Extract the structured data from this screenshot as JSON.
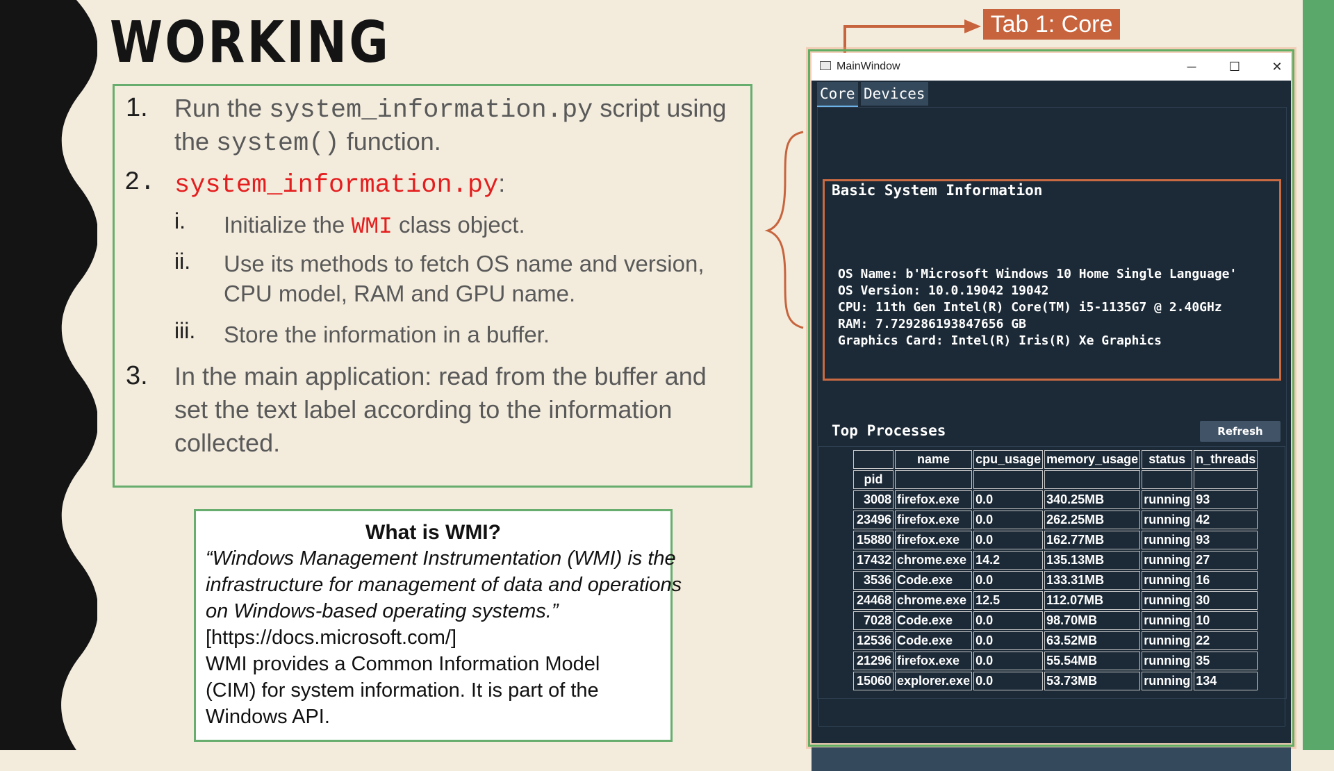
{
  "slide": {
    "title": "WORKING",
    "steps": [
      {
        "num": "1.",
        "line1_a": "Run the ",
        "line1_code": "system_information.py",
        "line1_b": " script using",
        "line2_a": "the ",
        "line2_code": "system()",
        "line2_b": " function."
      },
      {
        "num": "2.",
        "code": "system_information.py",
        "colon": ":"
      },
      {
        "num": "3.",
        "lines": [
          "In the main application: read from the buffer and",
          "set the text label according to the information",
          "collected."
        ]
      }
    ],
    "substeps": [
      {
        "num": "i.",
        "a": "Initialize the ",
        "code": "WMI",
        "b": " class object."
      },
      {
        "num": "ii.",
        "lines": [
          "Use its methods to fetch OS name and version,",
          "CPU model, RAM and GPU name."
        ]
      },
      {
        "num": "iii.",
        "text": "Store the information in a buffer."
      }
    ],
    "wmi": {
      "title": "What is WMI?",
      "quote": [
        "“Windows Management Instrumentation (WMI) is the",
        "infrastructure for management of data and operations",
        "on Windows-based operating systems.”"
      ],
      "source": "[https://docs.microsoft.com/]",
      "body": [
        "WMI provides a Common Information Model",
        "(CIM) for system information. It is part of the",
        "Windows API."
      ]
    },
    "tab_callout": "Tab 1: Core"
  },
  "window": {
    "title": "MainWindow",
    "controls": {
      "minimize": "─",
      "maximize": "☐",
      "close": "✕"
    },
    "tabs": [
      "Core",
      "Devices"
    ],
    "active_tab": "Core",
    "basic_info": {
      "title": "Basic System Information",
      "lines": [
        "OS Name: b'Microsoft Windows 10 Home Single Language'",
        "OS Version: 10.0.19042 19042",
        "CPU: 11th Gen Intel(R) Core(TM) i5-1135G7 @ 2.40GHz",
        "RAM: 7.729286193847656 GB",
        "Graphics Card: Intel(R) Iris(R) Xe Graphics"
      ]
    },
    "processes": {
      "title": "Top Processes",
      "refresh_label": "Refresh",
      "columns": [
        "name",
        "cpu_usage",
        "memory_usage",
        "status",
        "n_threads"
      ],
      "index_label": "pid",
      "rows": [
        [
          "3008",
          "firefox.exe",
          "0.0",
          "340.25MB",
          "running",
          "93"
        ],
        [
          "23496",
          "firefox.exe",
          "0.0",
          "262.25MB",
          "running",
          "42"
        ],
        [
          "15880",
          "firefox.exe",
          "0.0",
          "162.77MB",
          "running",
          "93"
        ],
        [
          "17432",
          "chrome.exe",
          "14.2",
          "135.13MB",
          "running",
          "27"
        ],
        [
          "3536",
          "Code.exe",
          "0.0",
          "133.31MB",
          "running",
          "16"
        ],
        [
          "24468",
          "chrome.exe",
          "12.5",
          "112.07MB",
          "running",
          "30"
        ],
        [
          "7028",
          "Code.exe",
          "0.0",
          "98.70MB",
          "running",
          "10"
        ],
        [
          "12536",
          "Code.exe",
          "0.0",
          "63.52MB",
          "running",
          "22"
        ],
        [
          "21296",
          "firefox.exe",
          "0.0",
          "55.54MB",
          "running",
          "35"
        ],
        [
          "15060",
          "explorer.exe",
          "0.0",
          "53.73MB",
          "running",
          "134"
        ]
      ]
    }
  },
  "colors": {
    "green_border": "#67ad6d",
    "orange_accent": "#c7643d",
    "code_red": "#e41e1e",
    "app_bg": "#1c2a37"
  }
}
